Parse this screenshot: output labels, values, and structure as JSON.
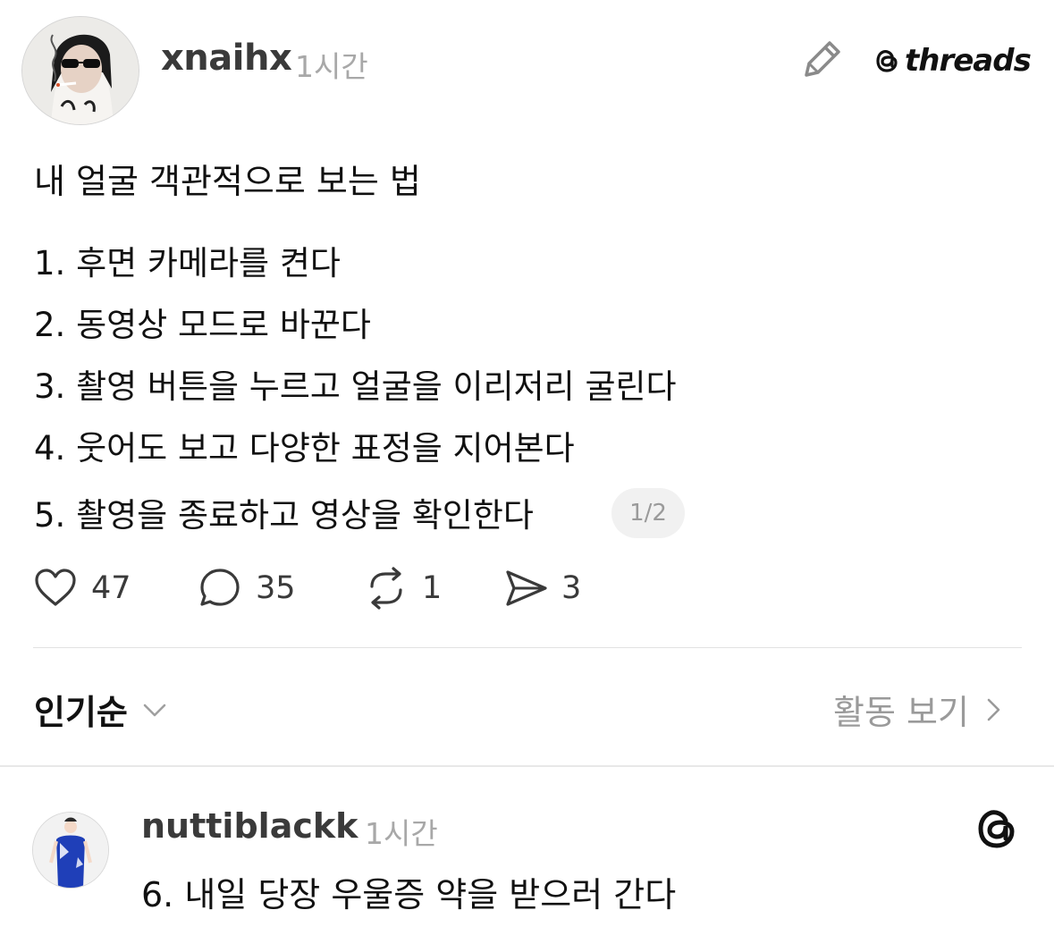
{
  "post": {
    "username": "xnaihx",
    "time": "1시간",
    "brand": "threads",
    "title": "내 얼굴 객관적으로 보는 법",
    "steps": [
      "1. 후면 카메라를 켠다",
      "2. 동영상 모드로 바꾼다",
      "3. 촬영 버튼을 누르고 얼굴을 이리저리 굴린다",
      "4. 웃어도 보고 다양한 표정을 지어본다",
      "5. 촬영을 종료하고 영상을 확인한다"
    ],
    "page_indicator": "1/2",
    "actions": {
      "likes": "47",
      "comments": "35",
      "reposts": "1",
      "shares": "3"
    }
  },
  "toolbar": {
    "sort_label": "인기순",
    "activity_label": "활동 보기"
  },
  "reply": {
    "username": "nuttiblackk",
    "time": "1시간",
    "text": "6. 내일 당장 우울증 약을 받으러 간다"
  },
  "icons": {
    "edit": "pencil-icon",
    "brand": "threads-logo-icon",
    "like": "heart-icon",
    "comment": "comment-bubble-icon",
    "repost": "repost-icon",
    "share": "send-icon",
    "sort": "chevron-down-icon",
    "activity": "chevron-right-icon"
  },
  "colors": {
    "text": "#111111",
    "muted": "#9a9a9a",
    "badge_bg": "#f1f1f1",
    "reply_avatar_accent": "#1f3fb8"
  }
}
